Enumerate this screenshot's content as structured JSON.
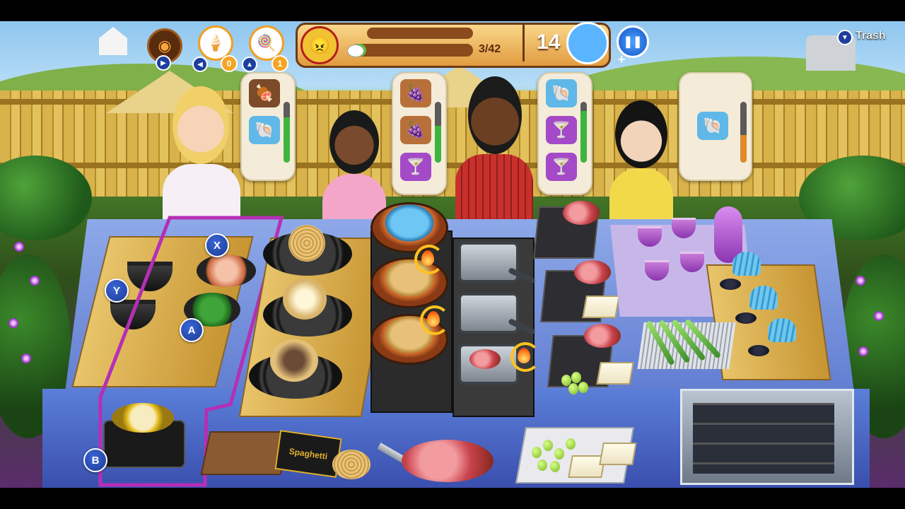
{
  "hud": {
    "smoke_powerup_icon": "smoke-powerup",
    "icecream_count": "0",
    "popsicle_count": "1",
    "no_angry_icon": "no-angry-face",
    "served_progress": "3/42",
    "served_fraction": 0.071,
    "customers_count": "14",
    "trash_label": "Trash"
  },
  "controls": {
    "x_label": "X",
    "y_label": "Y",
    "a_label": "A",
    "b_label": "B"
  },
  "customers": [
    {
      "name": "blonde-woman",
      "orders": [
        "truffle-meat-plate",
        "caviar-shell"
      ],
      "patience": 0.75,
      "patience_color": "#3fb53f"
    },
    {
      "name": "girl",
      "orders": [
        "ham-and-grapes",
        "ham-and-grapes",
        "purple-cocktail"
      ],
      "patience": 0.6,
      "patience_color": "#3fb53f"
    },
    {
      "name": "man-red-shirt",
      "orders": [
        "caviar-shell",
        "purple-cocktail",
        "purple-cocktail"
      ],
      "patience": 0.85,
      "patience_color": "#3fb53f"
    },
    {
      "name": "woman-black-hair",
      "orders": [
        "caviar-shell"
      ],
      "patience": 0.45,
      "patience_color": "#e08a2a"
    }
  ],
  "shelf": {
    "spaghetti_box_label": "Spaghetti"
  },
  "colors": {
    "selection_outline": "#b52fb5",
    "control_button": "#1d3f9e",
    "progress_fill": "#59c33c"
  }
}
